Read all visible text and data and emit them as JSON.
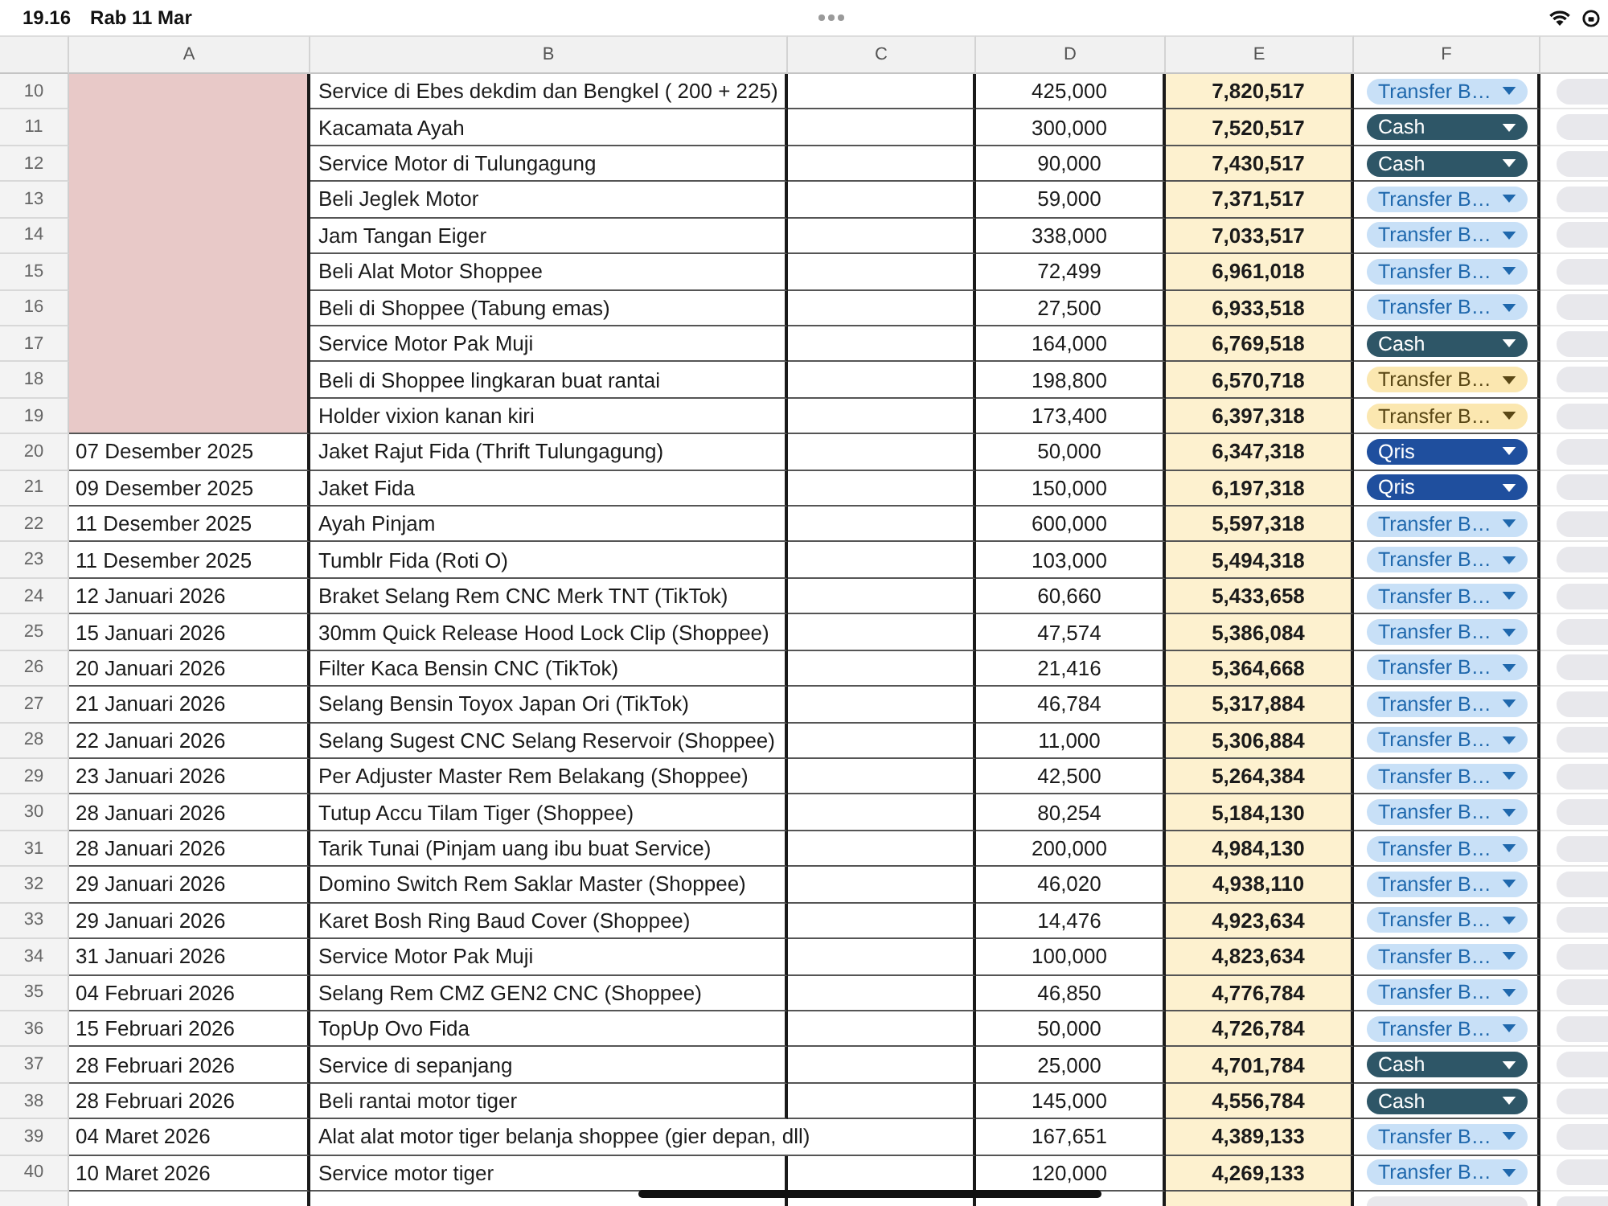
{
  "status_bar": {
    "time": "19.16",
    "date": "Rab 11 Mar"
  },
  "sheet": {
    "column_headers": [
      "A",
      "B",
      "C",
      "D",
      "E",
      "F"
    ],
    "rows": [
      {
        "number": "10",
        "kind": "merged",
        "description": "Service di Ebes dekdim dan Bengkel ( 200 + 225)",
        "amount": "425,000",
        "balance": "7,820,517",
        "payment": {
          "label": "Transfer B…",
          "color": "#c8e0f7"
        }
      },
      {
        "number": "11",
        "kind": "merged",
        "description": "Kacamata Ayah",
        "amount": "300,000",
        "balance": "7,520,517",
        "payment": {
          "label": "Cash",
          "color": "#2e5667"
        }
      },
      {
        "number": "12",
        "kind": "merged",
        "description": "Service Motor di Tulungagung",
        "amount": "90,000",
        "balance": "7,430,517",
        "payment": {
          "label": "Cash",
          "color": "#2e5667"
        }
      },
      {
        "number": "13",
        "kind": "merged",
        "description": "Beli Jeglek Motor",
        "amount": "59,000",
        "balance": "7,371,517",
        "payment": {
          "label": "Transfer B…",
          "color": "#c8e0f7"
        }
      },
      {
        "number": "14",
        "kind": "merged",
        "description": "Jam Tangan Eiger",
        "amount": "338,000",
        "balance": "7,033,517",
        "payment": {
          "label": "Transfer B…",
          "color": "#c8e0f7"
        }
      },
      {
        "number": "15",
        "kind": "merged",
        "description": "Beli Alat Motor Shoppee",
        "amount": "72,499",
        "balance": "6,961,018",
        "payment": {
          "label": "Transfer B…",
          "color": "#c8e0f7"
        }
      },
      {
        "number": "16",
        "kind": "merged",
        "description": "Beli di Shoppee (Tabung emas)",
        "amount": "27,500",
        "balance": "6,933,518",
        "payment": {
          "label": "Transfer B…",
          "color": "#c8e0f7"
        }
      },
      {
        "number": "17",
        "kind": "merged",
        "description": "Service Motor Pak Muji",
        "amount": "164,000",
        "balance": "6,769,518",
        "payment": {
          "label": "Cash",
          "color": "#2e5667"
        }
      },
      {
        "number": "18",
        "kind": "merged",
        "description": "Beli di Shoppee lingkaran buat rantai",
        "amount": "198,800",
        "balance": "6,570,718",
        "payment": {
          "label": "Transfer B…",
          "color": "#fbe7b0"
        }
      },
      {
        "number": "19",
        "kind": "merged",
        "description": "Holder vixion kanan kiri",
        "amount": "173,400",
        "balance": "6,397,318",
        "payment": {
          "label": "Transfer B…",
          "color": "#fbe7b0"
        }
      },
      {
        "number": "20",
        "kind": "dated",
        "date": "07 Desember 2025",
        "description": "Jaket Rajut Fida (Thrift Tulungagung)",
        "amount": "50,000",
        "balance": "6,347,318",
        "payment": {
          "label": "Qris",
          "color": "#1f4f9e"
        }
      },
      {
        "number": "21",
        "kind": "dated",
        "date": "09 Desember 2025",
        "description": "Jaket Fida",
        "amount": "150,000",
        "balance": "6,197,318",
        "payment": {
          "label": "Qris",
          "color": "#1f4f9e"
        }
      },
      {
        "number": "22",
        "kind": "dated",
        "date": "11 Desember 2025",
        "description": "Ayah Pinjam",
        "amount": "600,000",
        "balance": "5,597,318",
        "payment": {
          "label": "Transfer B…",
          "color": "#c8e0f7"
        }
      },
      {
        "number": "23",
        "kind": "dated",
        "date": "11 Desember 2025",
        "description": "Tumblr Fida (Roti O)",
        "amount": "103,000",
        "balance": "5,494,318",
        "payment": {
          "label": "Transfer B…",
          "color": "#c8e0f7"
        }
      },
      {
        "number": "24",
        "kind": "dated",
        "date": "12 Januari 2026",
        "description": "Braket Selang Rem CNC Merk TNT (TikTok)",
        "amount": "60,660",
        "balance": "5,433,658",
        "payment": {
          "label": "Transfer B…",
          "color": "#c8e0f7"
        }
      },
      {
        "number": "25",
        "kind": "dated",
        "date": "15 Januari 2026",
        "description": "30mm Quick Release Hood Lock Clip (Shoppee)",
        "amount": "47,574",
        "balance": "5,386,084",
        "payment": {
          "label": "Transfer B…",
          "color": "#c8e0f7"
        }
      },
      {
        "number": "26",
        "kind": "dated",
        "date": "20 Januari 2026",
        "description": "Filter Kaca Bensin CNC (TikTok)",
        "amount": "21,416",
        "balance": "5,364,668",
        "payment": {
          "label": "Transfer B…",
          "color": "#c8e0f7"
        }
      },
      {
        "number": "27",
        "kind": "dated",
        "date": "21 Januari 2026",
        "description": "Selang Bensin Toyox Japan Ori (TikTok)",
        "amount": "46,784",
        "balance": "5,317,884",
        "payment": {
          "label": "Transfer B…",
          "color": "#c8e0f7"
        }
      },
      {
        "number": "28",
        "kind": "dated",
        "date": "22 Januari 2026",
        "description": "Selang Sugest CNC Selang Reservoir (Shoppee)",
        "amount": "11,000",
        "balance": "5,306,884",
        "payment": {
          "label": "Transfer B…",
          "color": "#c8e0f7"
        }
      },
      {
        "number": "29",
        "kind": "dated",
        "date": "23 Januari 2026",
        "description": "Per Adjuster Master Rem Belakang (Shoppee)",
        "amount": "42,500",
        "balance": "5,264,384",
        "payment": {
          "label": "Transfer B…",
          "color": "#c8e0f7"
        }
      },
      {
        "number": "30",
        "kind": "dated",
        "date": "28 Januari 2026",
        "description": "Tutup Accu Tilam Tiger (Shoppee)",
        "amount": "80,254",
        "balance": "5,184,130",
        "payment": {
          "label": "Transfer B…",
          "color": "#c8e0f7"
        }
      },
      {
        "number": "31",
        "kind": "dated",
        "date": "28 Januari 2026",
        "description": "Tarik Tunai (Pinjam uang ibu buat Service)",
        "amount": "200,000",
        "balance": "4,984,130",
        "payment": {
          "label": "Transfer B…",
          "color": "#c8e0f7"
        }
      },
      {
        "number": "32",
        "kind": "dated",
        "date": "29 Januari 2026",
        "description": "Domino Switch Rem Saklar Master (Shoppee)",
        "amount": "46,020",
        "balance": "4,938,110",
        "payment": {
          "label": "Transfer B…",
          "color": "#c8e0f7"
        }
      },
      {
        "number": "33",
        "kind": "dated",
        "date": "29 Januari 2026",
        "description": "Karet Bosh Ring Baud Cover (Shoppee)",
        "amount": "14,476",
        "balance": "4,923,634",
        "payment": {
          "label": "Transfer B…",
          "color": "#c8e0f7"
        }
      },
      {
        "number": "34",
        "kind": "dated",
        "date": "31 Januari 2026",
        "description": "Service Motor Pak Muji",
        "amount": "100,000",
        "balance": "4,823,634",
        "payment": {
          "label": "Transfer B…",
          "color": "#c8e0f7"
        }
      },
      {
        "number": "35",
        "kind": "dated",
        "date": "04 Februari 2026",
        "description": "Selang Rem CMZ GEN2 CNC (Shoppee)",
        "amount": "46,850",
        "balance": "4,776,784",
        "payment": {
          "label": "Transfer B…",
          "color": "#c8e0f7"
        }
      },
      {
        "number": "36",
        "kind": "dated",
        "date": "15 Februari 2026",
        "description": "TopUp Ovo Fida",
        "amount": "50,000",
        "balance": "4,726,784",
        "payment": {
          "label": "Transfer B…",
          "color": "#c8e0f7"
        }
      },
      {
        "number": "37",
        "kind": "dated",
        "date": "28 Februari 2026",
        "description": "Service di sepanjang",
        "amount": "25,000",
        "balance": "4,701,784",
        "payment": {
          "label": "Cash",
          "color": "#2e5667"
        }
      },
      {
        "number": "38",
        "kind": "dated",
        "date": "28 Februari 2026",
        "description": "Beli rantai motor tiger",
        "amount": "145,000",
        "balance": "4,556,784",
        "payment": {
          "label": "Cash",
          "color": "#2e5667"
        }
      },
      {
        "number": "39",
        "kind": "dated",
        "date": "04 Maret 2026",
        "description": "Alat alat motor tiger belanja shoppee (gier depan, dll)",
        "amount": "167,651",
        "balance": "4,389,133",
        "payment": {
          "label": "Transfer B…",
          "color": "#c8e0f7"
        }
      },
      {
        "number": "40",
        "kind": "dated",
        "date": "10 Maret 2026",
        "description": "Service motor tiger",
        "amount": "120,000",
        "balance": "4,269,133",
        "payment": {
          "label": "Transfer B…",
          "color": "#c8e0f7"
        }
      }
    ]
  }
}
